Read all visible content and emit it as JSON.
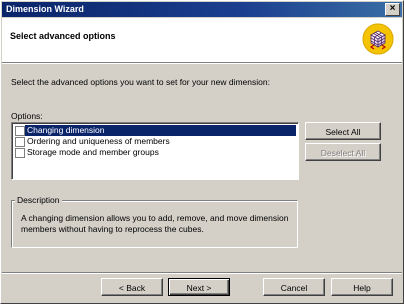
{
  "window": {
    "title": "Dimension Wizard",
    "close_label": "x"
  },
  "header": {
    "title": "Select advanced options",
    "icon": "cube-icon"
  },
  "main": {
    "instruction": "Select the advanced options you want to set for your new dimension:",
    "options_label": "Options:",
    "options": [
      {
        "label": "Changing dimension",
        "checked": false,
        "selected": true
      },
      {
        "label": "Ordering and uniqueness of members",
        "checked": false,
        "selected": false
      },
      {
        "label": "Storage mode and member groups",
        "checked": false,
        "selected": false
      }
    ],
    "select_all_label": "Select All",
    "deselect_all_label": "Deselect All"
  },
  "description": {
    "legend": "Description",
    "text": "A changing dimension allows you to add, remove, and move dimension members without having to reprocess the cubes."
  },
  "footer": {
    "back_label": "< Back",
    "next_label": "Next >",
    "cancel_label": "Cancel",
    "help_label": "Help"
  },
  "colors": {
    "titlebar": "#0a246a",
    "selection": "#0a246a",
    "face": "#d4d0c8",
    "icon_bg": "#f5c400"
  }
}
